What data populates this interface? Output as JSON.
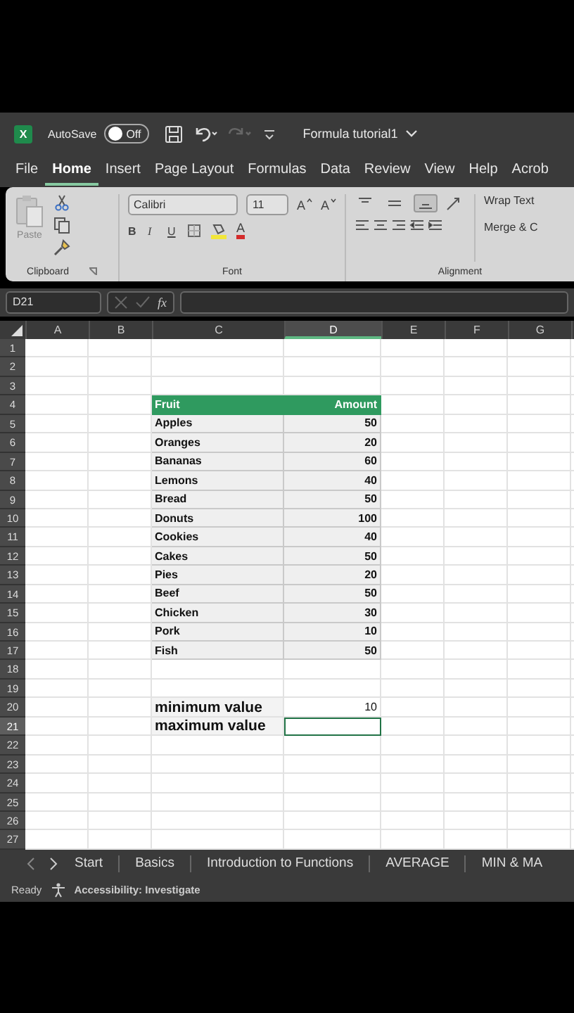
{
  "title_bar": {
    "logo": "X",
    "autosave_label": "AutoSave",
    "autosave": {
      "on": false,
      "label": "Off"
    },
    "redo_disabled": true,
    "document_title": "Formula tutorial1"
  },
  "menu_tabs": [
    {
      "label": "File",
      "selected": false
    },
    {
      "label": "Home",
      "selected": true
    },
    {
      "label": "Insert",
      "selected": false
    },
    {
      "label": "Page Layout",
      "selected": false
    },
    {
      "label": "Formulas",
      "selected": false
    },
    {
      "label": "Data",
      "selected": false
    },
    {
      "label": "Review",
      "selected": false
    },
    {
      "label": "View",
      "selected": false
    },
    {
      "label": "Help",
      "selected": false
    },
    {
      "label": "Acrob",
      "selected": false
    }
  ],
  "ribbon": {
    "clipboard": {
      "paste_label": "Paste",
      "group_label": "Clipboard"
    },
    "font": {
      "font_name": "Calibri",
      "font_size": "11",
      "grow_label": "A",
      "shrink_label": "A",
      "bold": "B",
      "italic": "I",
      "underline": "U",
      "font_color_label": "A",
      "group_label": "Font"
    },
    "alignment": {
      "vertical_align": [
        {
          "kind": "top",
          "selected": false
        },
        {
          "kind": "middle",
          "selected": false
        },
        {
          "kind": "bottom",
          "selected": true
        }
      ],
      "wrap_text": "Wrap Text",
      "merge": "Merge & C",
      "group_label": "Alignment"
    }
  },
  "formula_bar": {
    "name_box": "D21",
    "fx": "fx"
  },
  "columns": [
    {
      "label": "A",
      "selected": false
    },
    {
      "label": "B",
      "selected": false
    },
    {
      "label": "C",
      "selected": false
    },
    {
      "label": "D",
      "selected": true
    },
    {
      "label": "E",
      "selected": false
    },
    {
      "label": "F",
      "selected": false
    },
    {
      "label": "G",
      "selected": false
    }
  ],
  "rows": [
    {
      "number": "1",
      "selected": false,
      "kind": "empty"
    },
    {
      "number": "2",
      "selected": false,
      "kind": "empty"
    },
    {
      "number": "3",
      "selected": false,
      "kind": "empty"
    },
    {
      "number": "4",
      "selected": false,
      "kind": "table-header",
      "c": "Fruit",
      "d": "Amount"
    },
    {
      "number": "5",
      "selected": false,
      "kind": "table-row",
      "c": "Apples",
      "d": "50"
    },
    {
      "number": "6",
      "selected": false,
      "kind": "table-row",
      "c": "Oranges",
      "d": "20"
    },
    {
      "number": "7",
      "selected": false,
      "kind": "table-row",
      "c": "Bananas",
      "d": "60"
    },
    {
      "number": "8",
      "selected": false,
      "kind": "table-row",
      "c": "Lemons",
      "d": "40"
    },
    {
      "number": "9",
      "selected": false,
      "kind": "table-row",
      "c": "Bread",
      "d": "50"
    },
    {
      "number": "10",
      "selected": false,
      "kind": "table-row",
      "c": "Donuts",
      "d": "100"
    },
    {
      "number": "11",
      "selected": false,
      "kind": "table-row",
      "c": "Cookies",
      "d": "40"
    },
    {
      "number": "12",
      "selected": false,
      "kind": "table-row",
      "c": "Cakes",
      "d": "50"
    },
    {
      "number": "13",
      "selected": false,
      "kind": "table-row",
      "c": "Pies",
      "d": "20"
    },
    {
      "number": "14",
      "selected": false,
      "kind": "table-row",
      "c": "Beef",
      "d": "50"
    },
    {
      "number": "15",
      "selected": false,
      "kind": "table-row",
      "c": "Chicken",
      "d": "30"
    },
    {
      "number": "16",
      "selected": false,
      "kind": "table-row",
      "c": "Pork",
      "d": "10"
    },
    {
      "number": "17",
      "selected": false,
      "kind": "table-row",
      "c": "Fish",
      "d": "50"
    },
    {
      "number": "18",
      "selected": false,
      "kind": "empty"
    },
    {
      "number": "19",
      "selected": false,
      "kind": "empty"
    },
    {
      "number": "20",
      "selected": false,
      "kind": "summary",
      "c": "minimum value",
      "d": "10"
    },
    {
      "number": "21",
      "selected": true,
      "kind": "summary",
      "c": "maximum value"
    },
    {
      "number": "22",
      "selected": false,
      "kind": "empty"
    },
    {
      "number": "23",
      "selected": false,
      "kind": "empty"
    },
    {
      "number": "24",
      "selected": false,
      "kind": "empty"
    },
    {
      "number": "25",
      "selected": false,
      "kind": "empty"
    },
    {
      "number": "26",
      "selected": false,
      "kind": "empty"
    },
    {
      "number": "27",
      "selected": false,
      "kind": "empty"
    }
  ],
  "sheet_tabs": [
    "Start",
    "Basics",
    "Introduction to Functions",
    "AVERAGE",
    "MIN & MA"
  ],
  "status_bar": {
    "ready": "Ready",
    "accessibility": "Accessibility: Investigate"
  }
}
